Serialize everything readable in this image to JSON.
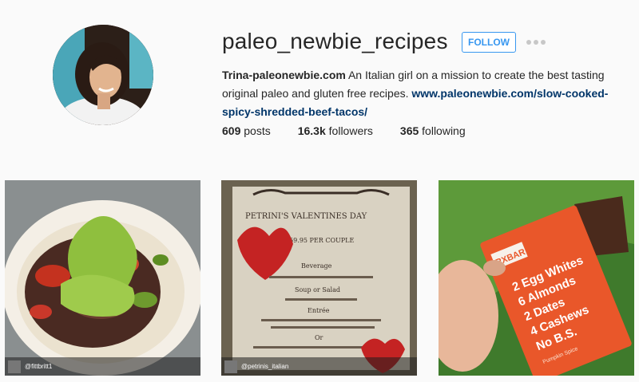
{
  "profile": {
    "username": "paleo_newbie_recipes",
    "follow_label": "FOLLOW",
    "more_icon": "more-options-icon",
    "bio_name": "Trina-paleonewbie.com",
    "bio_text": " An Italian girl on a mission to create the best tasting original paleo and gluten free recipes. ",
    "bio_link": "www.paleonewbie.com/slow-cooked-spicy-shredded-beef-tacos/",
    "stats": {
      "posts_count": "609",
      "posts_label": " posts",
      "followers_count": "16.3k",
      "followers_label": " followers",
      "following_count": "365",
      "following_label": " following"
    }
  },
  "colors": {
    "accent": "#3897f0",
    "link": "#003569"
  },
  "posts": [
    {
      "credit": "@fittbritt1",
      "image": "tacos-with-guacamole"
    },
    {
      "credit": "@petrinis_italian",
      "image": "valentines-menu-card",
      "menu": {
        "title": "PETRINI'S VALENTINES DAY",
        "price": "$59.95 PER COUPLE",
        "beverage": "Beverage",
        "soup": "Soup or Salad",
        "entree": "Entrée",
        "or": "Or"
      }
    },
    {
      "credit": "",
      "image": "rxbar-protein-bar",
      "bar": {
        "brand": "RXBAR",
        "lines": [
          "2 Egg Whites",
          "6 Almonds",
          "2 Dates",
          "4 Cashews",
          "No B.S."
        ],
        "flavor": "Pumpkin Spice"
      }
    }
  ]
}
